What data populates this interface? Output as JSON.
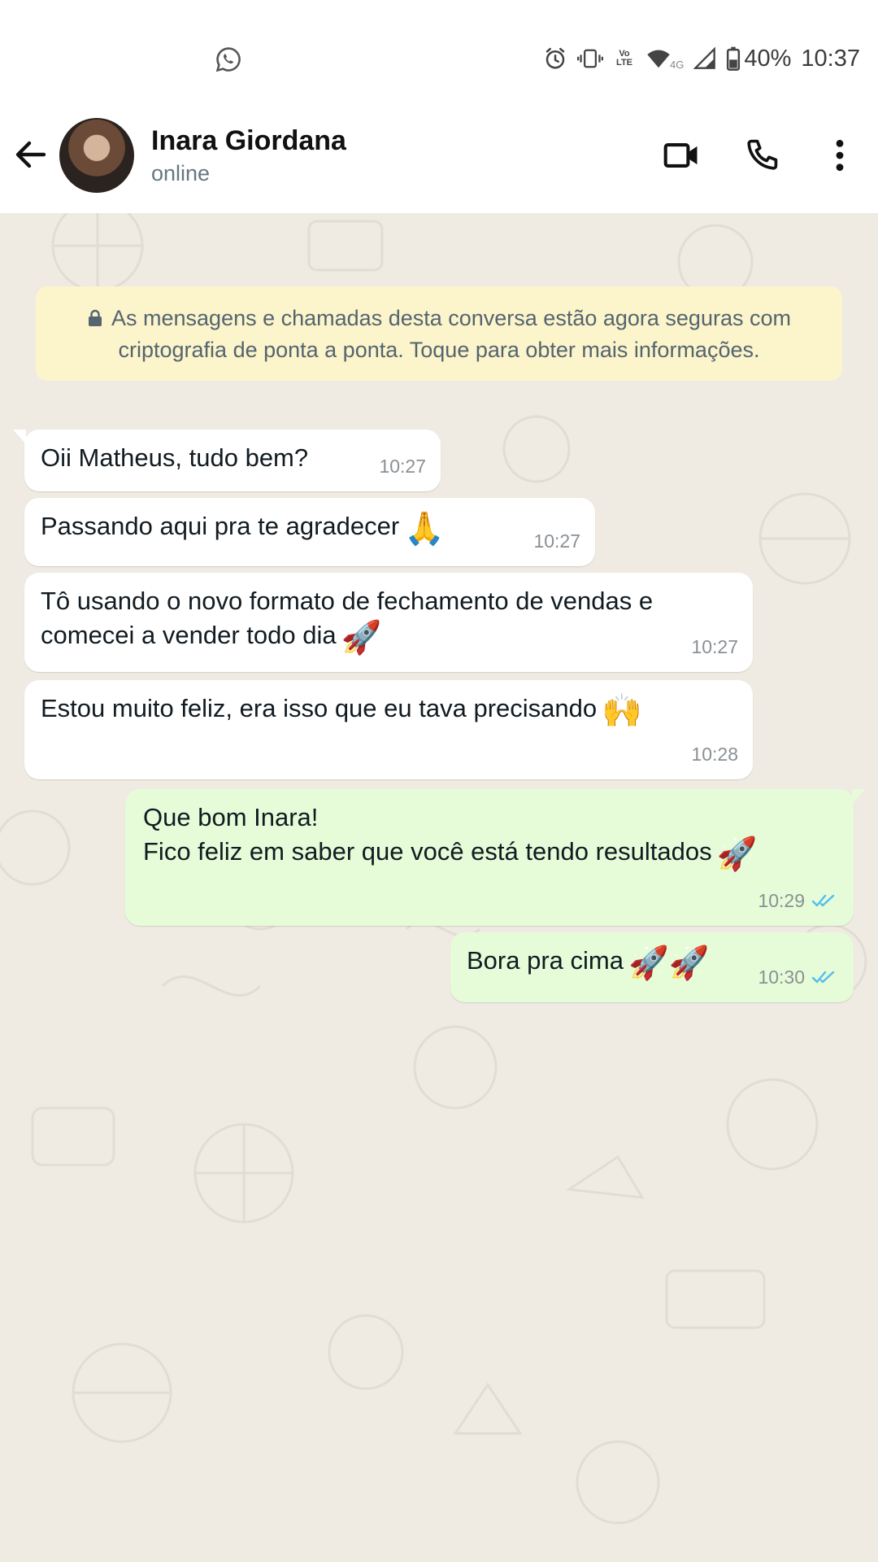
{
  "status_bar": {
    "battery": "40%",
    "time": "10:37",
    "network_lte": "Vo LTE",
    "network_4g": "4G"
  },
  "header": {
    "contact_name": "Inara Giordana",
    "contact_status": "online"
  },
  "e2e_notice": "As mensagens e chamadas desta conversa estão agora seguras com criptografia de ponta a ponta. Toque para obter mais informações.",
  "messages": [
    {
      "direction": "in",
      "text": "Oii Matheus, tudo bem?",
      "emoji": "",
      "time": "10:27"
    },
    {
      "direction": "in",
      "text": "Passando aqui pra te agradecer",
      "emoji": "🙏",
      "time": "10:27"
    },
    {
      "direction": "in",
      "text": "Tô usando o novo formato de fechamento de vendas e\ncomecei a vender todo dia",
      "emoji": "🚀",
      "time": "10:27"
    },
    {
      "direction": "in",
      "text": "Estou muito feliz, era isso que eu tava precisando",
      "emoji": "🙌",
      "time": "10:28"
    },
    {
      "direction": "out",
      "text": "Que bom Inara!\nFico feliz em saber que você está tendo resultados",
      "emoji": "🚀",
      "time": "10:29"
    },
    {
      "direction": "out",
      "text": "Bora pra cima",
      "emoji": "🚀🚀",
      "time": "10:30"
    }
  ],
  "colors": {
    "chat_background": "#efeae2",
    "incoming_bubble": "#ffffff",
    "outgoing_bubble": "#e6fcd8",
    "notice_background": "#fcf4cb",
    "read_ticks": "#53bdeb"
  },
  "icons": {
    "status_app": "whatsapp-icon",
    "back": "arrow-left-icon",
    "video": "video-camera-icon",
    "call": "phone-icon",
    "menu": "more-vertical-icon",
    "lock": "lock-icon",
    "read": "double-check-icon"
  }
}
